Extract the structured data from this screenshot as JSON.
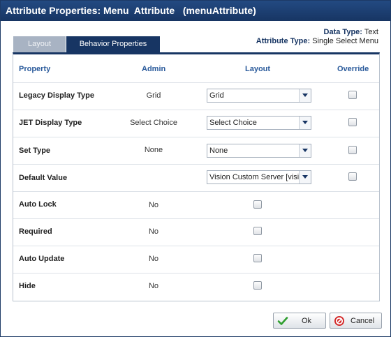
{
  "window": {
    "title": "Attribute Properties: Menu  Attribute   (menuAttribute)"
  },
  "meta": {
    "data_type_label": "Data Type:",
    "data_type_value": "Text",
    "attribute_type_label": "Attribute Type:",
    "attribute_type_value": "Single Select Menu"
  },
  "tabs": [
    {
      "label": "Layout",
      "active": false
    },
    {
      "label": "Behavior Properties",
      "active": true
    }
  ],
  "table": {
    "headers": {
      "property": "Property",
      "admin": "Admin",
      "layout": "Layout",
      "override": "Override"
    },
    "rows": [
      {
        "property": "Legacy Display Type",
        "admin": "Grid",
        "layout_select": "Grid",
        "override_checked": false
      },
      {
        "property": "JET Display Type",
        "admin": "Select Choice",
        "layout_select": "Select Choice",
        "override_checked": false
      },
      {
        "property": "Set Type",
        "admin": "None",
        "layout_select": "None",
        "override_checked": false
      },
      {
        "property": "Default Value",
        "admin": "",
        "layout_select": "Vision Custom Server [vision]",
        "override_checked": false
      },
      {
        "property": "Auto Lock",
        "admin": "No",
        "layout_checked": false
      },
      {
        "property": "Required",
        "admin": "No",
        "layout_checked": false
      },
      {
        "property": "Auto Update",
        "admin": "No",
        "layout_checked": false
      },
      {
        "property": "Hide",
        "admin": "No",
        "layout_checked": false
      }
    ]
  },
  "buttons": {
    "ok": "Ok",
    "cancel": "Cancel"
  },
  "colors": {
    "accent": "#173563",
    "header_text": "#2a5a9b",
    "ok_icon": "#2e9e2e",
    "cancel_icon": "#d42a2a"
  }
}
